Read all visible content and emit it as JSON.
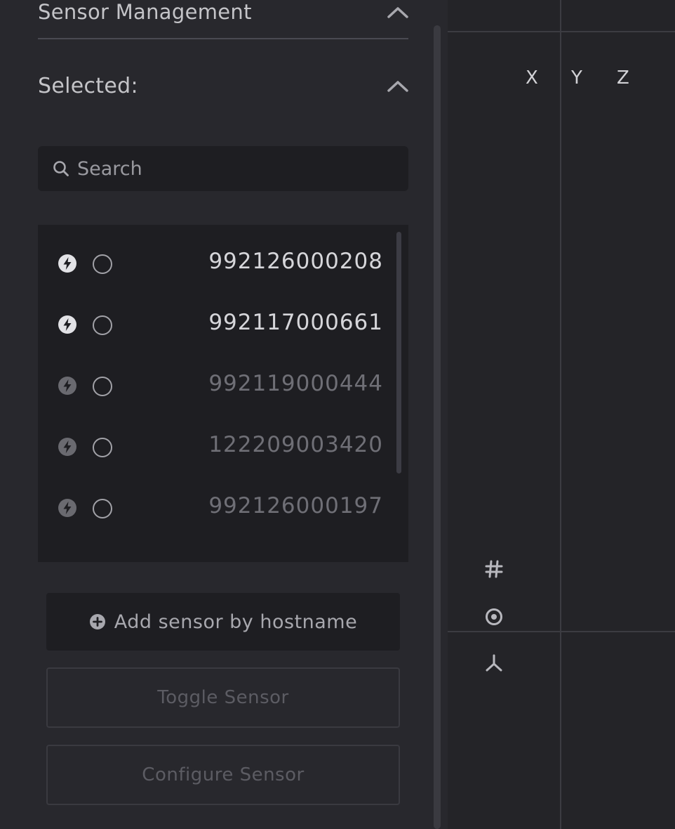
{
  "sensor_management": {
    "title": "Sensor Management",
    "chevron_icon": "chevron-up-icon"
  },
  "selected": {
    "title": "Selected:",
    "chevron_icon": "chevron-up-icon"
  },
  "search": {
    "placeholder": "Search",
    "value": "",
    "icon": "search-icon"
  },
  "sensors": [
    {
      "id": "992126000208",
      "status": "active",
      "icon": "bolt-icon"
    },
    {
      "id": "992117000661",
      "status": "active",
      "icon": "bolt-icon"
    },
    {
      "id": "992119000444",
      "status": "inactive",
      "icon": "bolt-icon"
    },
    {
      "id": "122209003420",
      "status": "inactive",
      "icon": "bolt-icon"
    },
    {
      "id": "992126000197",
      "status": "inactive",
      "icon": "bolt-icon"
    }
  ],
  "buttons": {
    "add_sensor": "Add sensor by hostname",
    "add_icon": "plus-circle-icon",
    "toggle_sensor": "Toggle Sensor",
    "configure_sensor": "Configure Sensor"
  },
  "viewport": {
    "axes": [
      "X",
      "Y",
      "Z"
    ],
    "tools": [
      "grid-icon",
      "target-icon",
      "axes-icon"
    ]
  },
  "colors": {
    "background": "#232327",
    "panel": "#28282d",
    "field": "#1e1e22",
    "text_active": "#d6d6da",
    "text_inactive": "#6f6f76"
  }
}
